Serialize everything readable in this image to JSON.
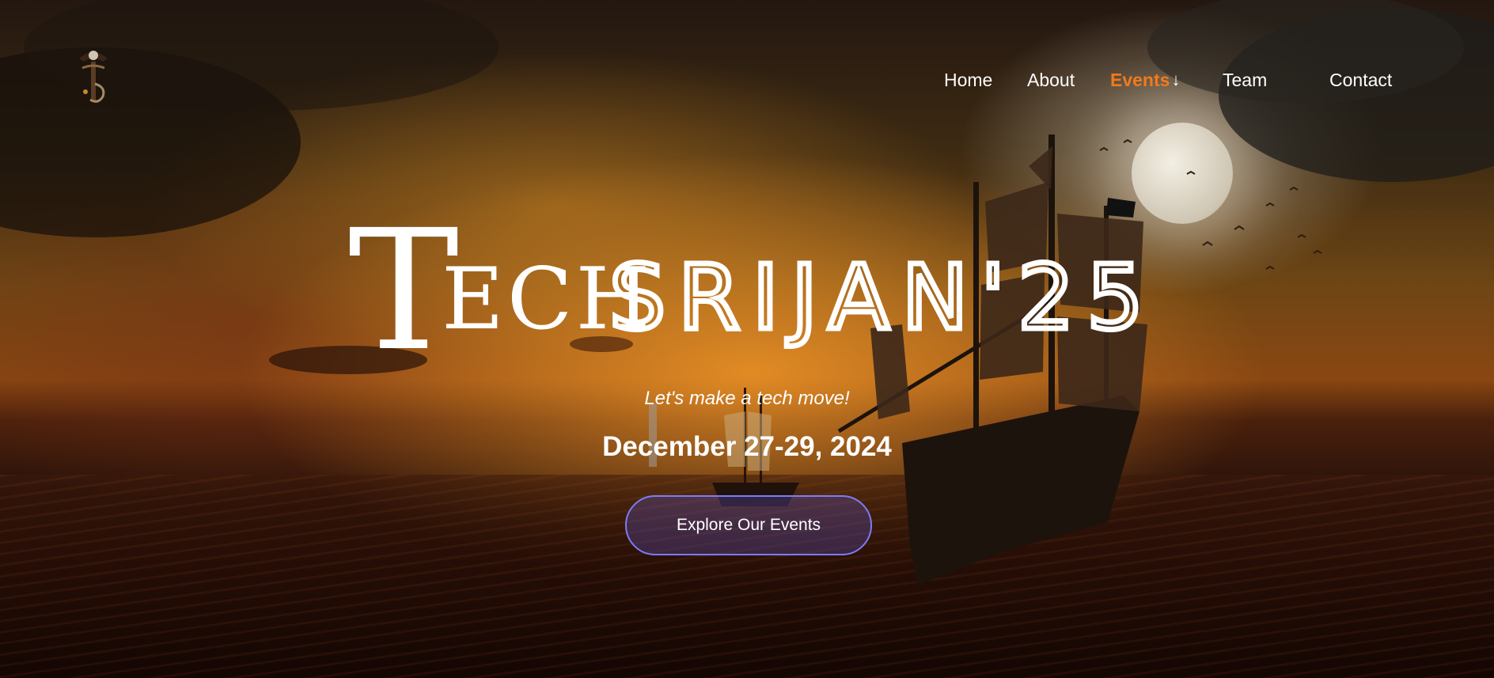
{
  "nav": {
    "items": [
      {
        "label": "Home"
      },
      {
        "label": "About"
      },
      {
        "label": "Events",
        "arrow": "↓",
        "active": true
      },
      {
        "label": "Team"
      },
      {
        "label": "Contact"
      }
    ]
  },
  "hero": {
    "title_initial": "T",
    "title_part1": "ECH",
    "title_part2": "SRIJAN'25",
    "tagline": "Let's make a tech move!",
    "date": "December 27-29, 2024",
    "cta_label": "Explore Our Events"
  },
  "colors": {
    "accent_active_nav": "#f07a1e",
    "button_border": "#7c7cf6",
    "text": "#ffffff"
  },
  "icons": {
    "logo": "pirate-skull-logo-icon",
    "events_dropdown": "arrow-down-icon"
  }
}
